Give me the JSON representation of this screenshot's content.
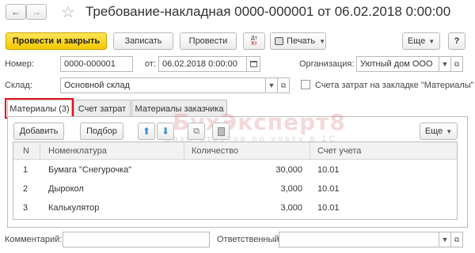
{
  "title": "Требование-накладная 0000-000001 от 06.02.2018 0:00:00",
  "nav": {
    "back_icon": "arrow-left-icon",
    "forward_icon": "arrow-right-icon",
    "favorite_icon": "star-icon"
  },
  "toolbar": {
    "post_close_label": "Провести и закрыть",
    "save_label": "Записать",
    "post_label": "Провести",
    "print_label": "Печать",
    "more_label": "Еще",
    "help_label": "?"
  },
  "header": {
    "number_label": "Номер:",
    "number_value": "0000-000001",
    "date_label": "от:",
    "date_value": "06.02.2018  0:00:00",
    "org_label": "Организация:",
    "org_value": "Уютный дом ООО",
    "warehouse_label": "Склад:",
    "warehouse_value": "Основной склад",
    "accounts_checkbox_label": "Счета затрат на закладке \"Материалы\""
  },
  "tabs": [
    {
      "label": "Материалы (3)"
    },
    {
      "label": "Счет затрат"
    },
    {
      "label": "Материалы заказчика"
    }
  ],
  "table_toolbar": {
    "add_label": "Добавить",
    "select_label": "Подбор",
    "more_label": "Еще"
  },
  "table": {
    "columns": [
      "N",
      "Номенклатура",
      "Количество",
      "Счет учета"
    ],
    "rows": [
      {
        "n": "1",
        "item": "Бумага \"Снегурочка\"",
        "qty": "30,000",
        "account": "10.01"
      },
      {
        "n": "2",
        "item": "Дырокол",
        "qty": "3,000",
        "account": "10.01"
      },
      {
        "n": "3",
        "item": "Калькулятор",
        "qty": "3,000",
        "account": "10.01"
      }
    ]
  },
  "footer": {
    "comment_label": "Комментарий:",
    "comment_value": "",
    "responsible_label": "Ответственный:",
    "responsible_value": ""
  },
  "watermark": {
    "text": "БухЭксперт8",
    "subtext": "Базы ответов по учету в 1С"
  },
  "colors": {
    "primary_button": "#f5c800",
    "highlight": "#e0141e",
    "arrow_blue": "#3a8fd9"
  }
}
